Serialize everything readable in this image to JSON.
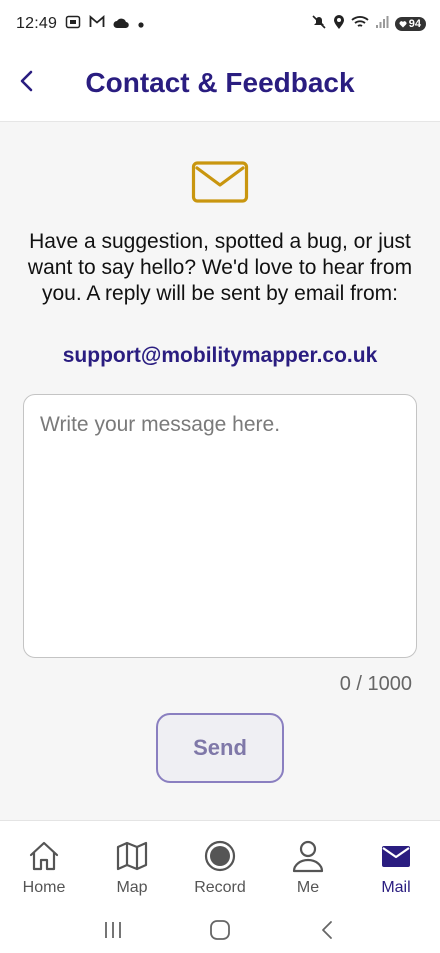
{
  "status_bar": {
    "time": "12:49",
    "battery": "94",
    "left_icons": [
      "screenshot-icon",
      "gmail-icon",
      "cloud-icon",
      "dot-icon"
    ],
    "right_icons": [
      "mute-icon",
      "location-icon",
      "wifi-icon",
      "signal-icon",
      "battery-icon"
    ]
  },
  "header": {
    "title": "Contact & Feedback",
    "back_icon": "chevron-left-icon"
  },
  "main": {
    "hero_icon": "envelope-icon",
    "intro_text": "Have a suggestion, spotted a bug, or just want to say hello? We'd love to hear from you. A reply will be sent by email from:",
    "email": "support@mobilitymapper.co.uk",
    "message_placeholder": "Write your message here.",
    "message_value": "",
    "char_count": "0 / 1000",
    "send_label": "Send"
  },
  "bottom_nav": {
    "items": [
      {
        "label": "Home",
        "icon": "home-icon",
        "active": false
      },
      {
        "label": "Map",
        "icon": "map-icon",
        "active": false
      },
      {
        "label": "Record",
        "icon": "record-icon",
        "active": false
      },
      {
        "label": "Me",
        "icon": "person-icon",
        "active": false
      },
      {
        "label": "Mail",
        "icon": "mail-icon",
        "active": true
      }
    ]
  },
  "system_nav": {
    "icons": [
      "recent-apps-icon",
      "home-circle-icon",
      "back-arrow-icon"
    ]
  },
  "colors": {
    "brand": "#2a1d80",
    "hero_icon": "#c9960f",
    "background": "#f6f6f6",
    "send_border": "#8a7fc0"
  }
}
